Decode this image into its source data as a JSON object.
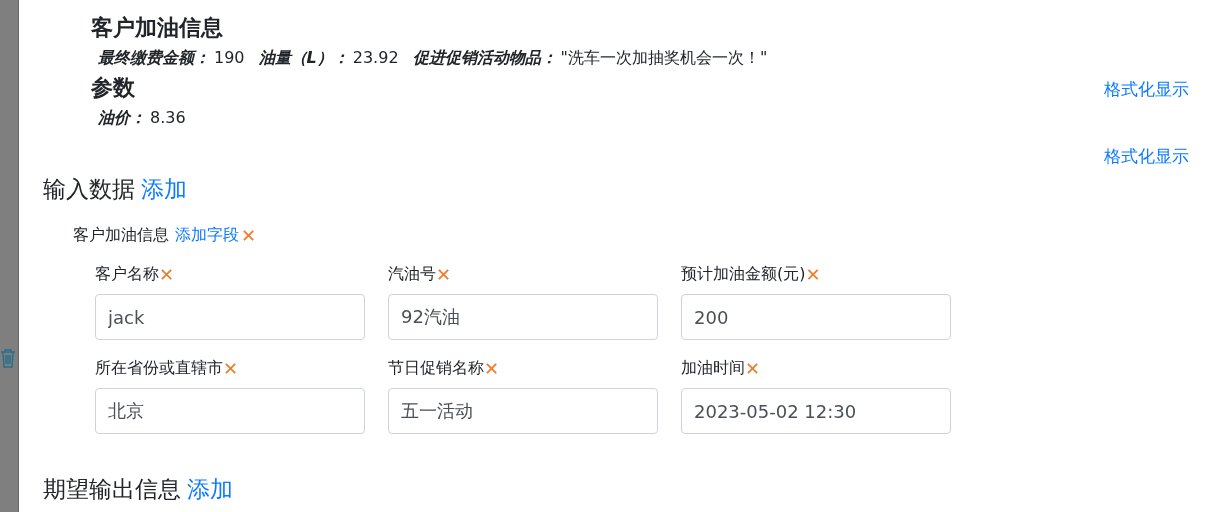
{
  "preview": {
    "sections": [
      {
        "title": "客户加油信息",
        "fields": [
          {
            "label": "最终缴费金额：",
            "value": "190"
          },
          {
            "label": "油量（L）：",
            "value": "23.92"
          },
          {
            "label": "促进促销活动物品：",
            "value": "\"洗车一次加抽奖机会一次！\""
          }
        ]
      },
      {
        "title": "参数",
        "fields": [
          {
            "label": "油价：",
            "value": "8.36"
          }
        ]
      }
    ],
    "format_links": [
      "格式化显示",
      "格式化显示"
    ]
  },
  "input_data": {
    "title": "输入数据",
    "add_link": "添加",
    "group": {
      "name": "客户加油信息",
      "add_field_link": "添加字段",
      "remove": "✕",
      "fields": [
        {
          "label": "客户名称",
          "value": "jack",
          "remove": "✕"
        },
        {
          "label": "汽油号",
          "value": "92汽油",
          "remove": "✕"
        },
        {
          "label": "预计加油金额(元)",
          "value": "200",
          "remove": "✕"
        },
        {
          "label": "所在省份或直辖市",
          "value": "北京",
          "remove": "✕"
        },
        {
          "label": "节日促销名称",
          "value": "五一活动",
          "remove": "✕"
        },
        {
          "label": "加油时间",
          "value": "2023-05-02 12:30",
          "remove": "✕"
        }
      ]
    }
  },
  "expected_output": {
    "title": "期望输出信息",
    "add_link": "添加"
  }
}
